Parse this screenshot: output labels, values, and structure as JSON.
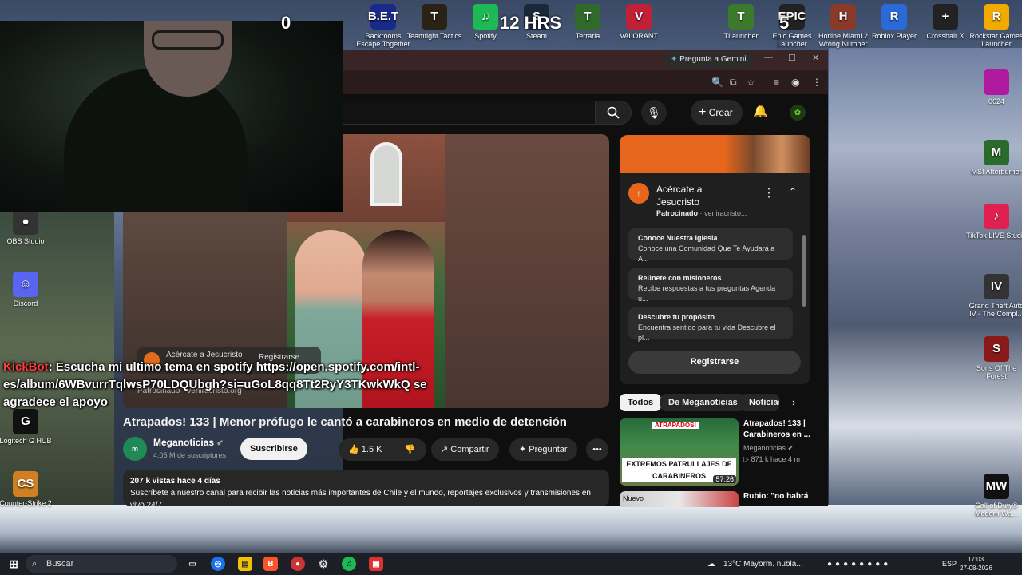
{
  "overlay": {
    "counter": "0",
    "digit": "5",
    "timer": "12 HRS"
  },
  "desktop": {
    "top_icons": [
      {
        "label": "Backrooms Escape Together",
        "short": "B.E.T",
        "color": "#1a2a8a"
      },
      {
        "label": "Teamfight Tactics",
        "short": "T",
        "color": "#2a2214"
      },
      {
        "label": "Spotify",
        "short": "♫",
        "color": "#1db954"
      },
      {
        "label": "Steam",
        "short": "S",
        "color": "#1b2838"
      },
      {
        "label": "Terraria",
        "short": "T",
        "color": "#2f6a2a"
      },
      {
        "label": "VALORANT",
        "short": "V",
        "color": "#c02038"
      },
      {
        "label": "TLauncher",
        "short": "T",
        "color": "#3a7a2a"
      },
      {
        "label": "Epic Games Launcher",
        "short": "EPIC",
        "color": "#222"
      },
      {
        "label": "Hotline Miami 2 Wrong Number",
        "short": "H",
        "color": "#8a3a2a"
      },
      {
        "label": "Roblox Player",
        "short": "R",
        "color": "#2a6ad6"
      },
      {
        "label": "Crosshair X",
        "short": "+",
        "color": "#222"
      },
      {
        "label": "Rockstar Games Launcher",
        "short": "R",
        "color": "#f2a900"
      }
    ],
    "right_icons": [
      {
        "label": "0624",
        "short": "",
        "color": "#b01aa0"
      },
      {
        "label": "MSI Afterburner",
        "short": "M",
        "color": "#2a6a2a"
      },
      {
        "label": "TikTok LIVE Studio",
        "short": "♪",
        "color": "#e02050"
      },
      {
        "label": "Grand Theft Auto IV - The Compl...",
        "short": "IV",
        "color": "#333"
      },
      {
        "label": "Sons Of The Forest",
        "short": "S",
        "color": "#8a1a1a"
      },
      {
        "label": "Call of Duty® Modern Wa...",
        "short": "MW",
        "color": "#111"
      }
    ],
    "left_icons": [
      {
        "label": "OBS Studio",
        "short": "●",
        "color": "#333"
      },
      {
        "label": "Discord",
        "short": "☺",
        "color": "#5865f2"
      },
      {
        "label": "Logitech G HUB",
        "short": "G",
        "color": "#111"
      },
      {
        "label": "Counter-Strike 2",
        "short": "CS",
        "color": "#d08020"
      }
    ]
  },
  "browser": {
    "gemini_label": "Pregunta a Gemini",
    "crear_label": "Crear"
  },
  "video": {
    "ad_advertiser": "Acércate a Jesucristo",
    "ad_button": "Registrarse",
    "ad_sponsored": "Patrocinado",
    "ad_domain": "veniracristo.org",
    "title": "Atrapados! 133 | Menor prófugo le cantó a carabineros en medio de detención",
    "channel": "Meganoticias",
    "subscribers": "4.05 M de suscriptores",
    "subscribe_label": "Suscribirse",
    "likes": "1.5 K",
    "share_label": "Compartir",
    "ask_label": "Preguntar",
    "views": "207 k vistas  hace 4 días",
    "description": "Suscríbete a nuestro canal para recibir las noticias más importantes de Chile y el mundo, reportajes exclusivos y transmisiones en vivo 24/7"
  },
  "chat": {
    "user": "KickBot",
    "message": ": Escucha mi ultimo tema en spotify https://open.spotify.com/intl-es/album/6WBvurrTqlwsP70LDQUbgh?si=uGoL8qq8Tt2RyY3TKwkWkQ se agradece el apoyo"
  },
  "sidebar": {
    "ad": {
      "title": "Acércate a Jesucristo",
      "sponsored": "Patrocinado",
      "domain": "veniracristo...",
      "items": [
        {
          "title": "Conoce Nuestra Iglesia",
          "desc": "Conoce una Comunidad Que Te Ayudará a A..."
        },
        {
          "title": "Reúnete con misioneros",
          "desc": "Recibe respuestas a tus preguntas Agenda u..."
        },
        {
          "title": "Descubre tu propósito",
          "desc": "Encuentra sentido para tu vida Descubre el pl..."
        }
      ],
      "register_label": "Registrarse"
    },
    "chips": [
      "Todos",
      "De Meganoticias",
      "Noticias"
    ],
    "rec1": {
      "title": "Atrapados! 133 | Carabineros en ...",
      "channel": "Meganoticias",
      "meta": "871 k  hace 4 m",
      "thumb_tag": "ATRAPADOS!",
      "thumb_caption": "EXTREMOS PATRULLAJES DE CARABINEROS",
      "duration": "57:26"
    },
    "rec2": {
      "badge": "Nuevo",
      "title": "Rubio: \"no habrá"
    }
  },
  "taskbar": {
    "search_placeholder": "Buscar",
    "weather": "13°C  Mayorm. nubla...",
    "lang": "ESP",
    "time": "17:03",
    "date": "27-08-2026"
  }
}
